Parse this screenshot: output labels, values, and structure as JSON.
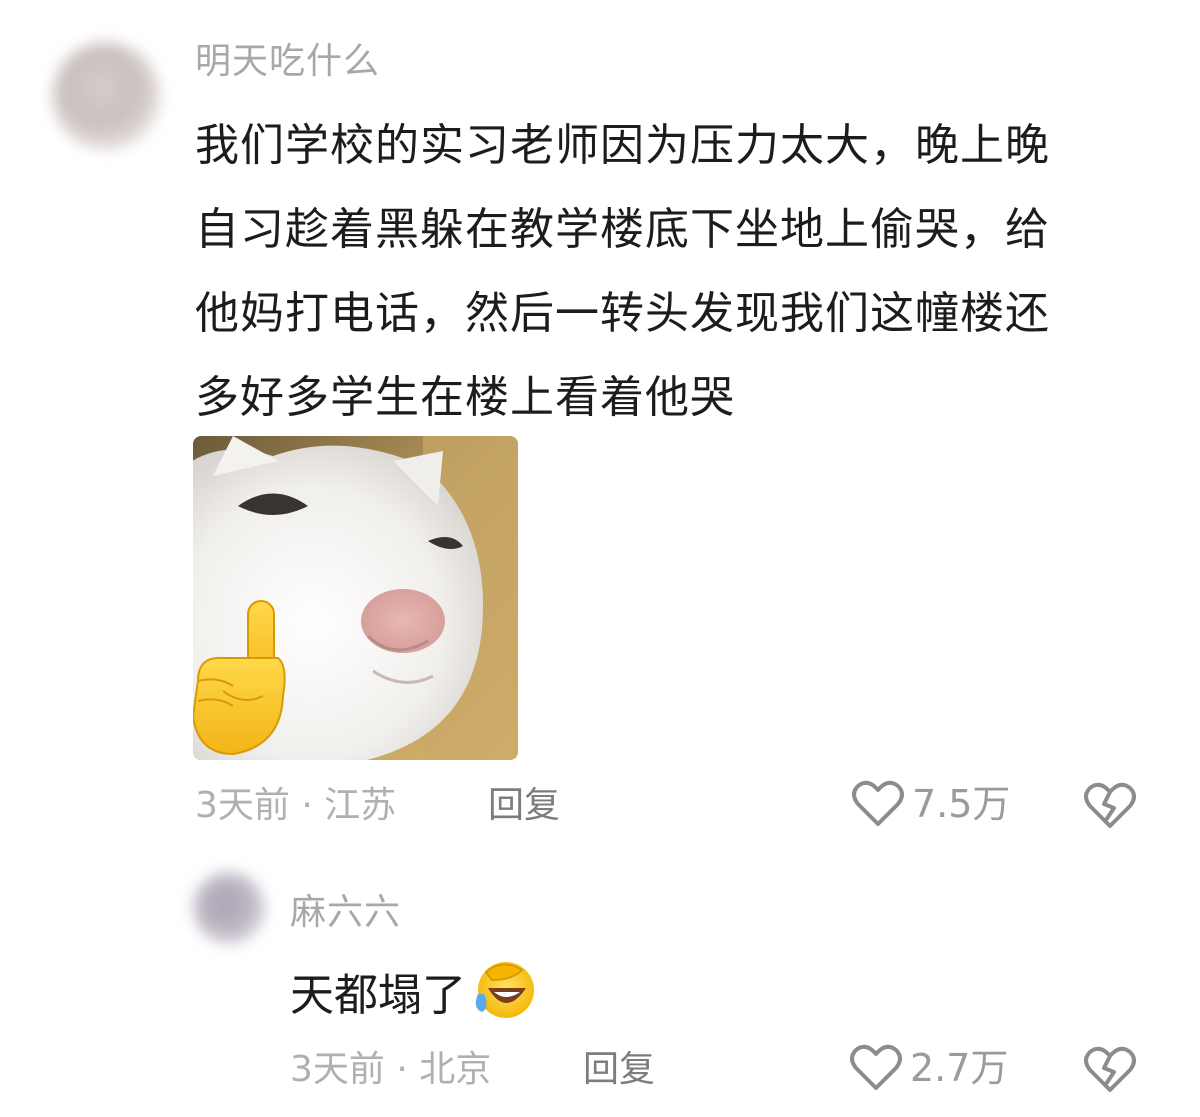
{
  "comment": {
    "username": "明天吃什么",
    "text_lines": [
      "我们学校的实习老师因为压力太大，晚上晚",
      "自习趁着黑躲在教学楼底下坐地上偷哭，给",
      "他妈打电话，然后一转头发现我们这幢楼还",
      "多好多学生在楼上看着他哭"
    ],
    "image_icon": "cat-pointing-image",
    "meta": "3天前 · 江苏",
    "reply_label": "回复",
    "likes": "7.5万",
    "like_icon": "heart-outline-icon",
    "dislike_icon": "broken-heart-icon"
  },
  "reply": {
    "username": "麻六六",
    "text": "天都塌了",
    "emoji": "face-palm-laugh-emoji",
    "meta": "3天前 · 北京",
    "reply_label": "回复",
    "likes": "2.7万"
  },
  "colors": {
    "username": "#a8a8a8",
    "text": "#1c1c1c",
    "meta": "#b0b0b0",
    "icon": "#8c8c8c"
  }
}
